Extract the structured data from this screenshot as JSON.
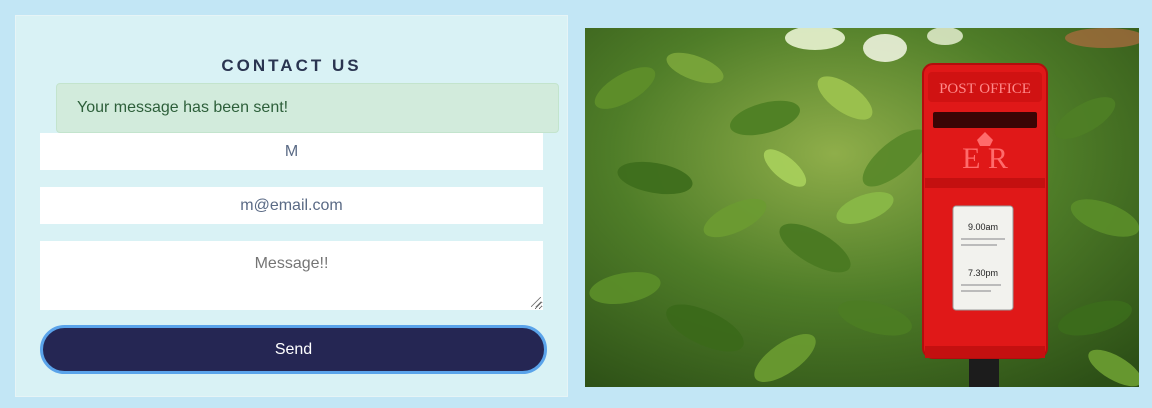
{
  "contact": {
    "title": "CONTACT US",
    "alert": "Your message has been sent!",
    "name_value": "M",
    "email_value": "m@email.com",
    "message_placeholder": "Message!!",
    "send_label": "Send"
  },
  "postbox": {
    "top_label": "POST OFFICE",
    "cipher": "E R",
    "plate_time_1": "9.00am",
    "plate_time_2": "7.30pm"
  },
  "colors": {
    "page_bg": "#c2e6f5",
    "card_bg": "#d9f2f5",
    "alert_bg": "#d2ebdc",
    "button_bg": "#252653",
    "button_border": "#5aa3ea",
    "postbox_red": "#e01818"
  }
}
